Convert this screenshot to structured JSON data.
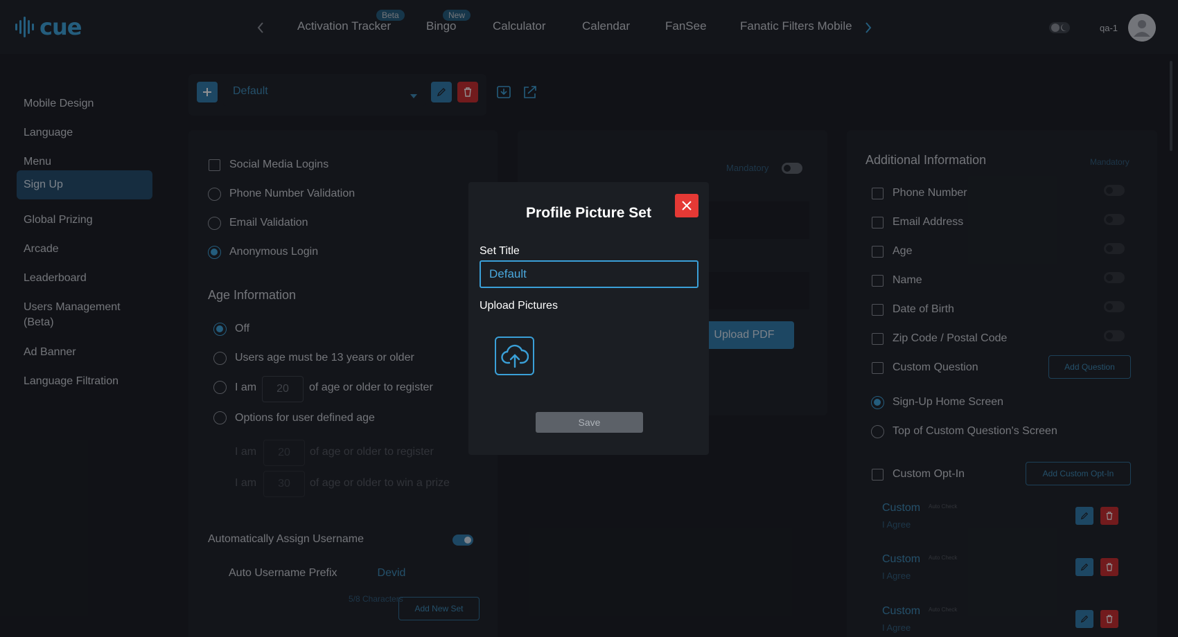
{
  "app": {
    "logo_text": "cue",
    "brand_color": "#3aa0d8"
  },
  "nav": {
    "tabs": [
      {
        "label": "Activation Tracker",
        "badge": "Beta"
      },
      {
        "label": "Bingo",
        "badge": "New"
      },
      {
        "label": "Calculator"
      },
      {
        "label": "Calendar"
      },
      {
        "label": "FanSee"
      },
      {
        "label": "Fanatic Filters Mobile"
      }
    ],
    "user": "qa-1"
  },
  "sidebar": {
    "items": [
      {
        "label": "Mobile Design"
      },
      {
        "label": "Language"
      },
      {
        "label": "Menu"
      },
      {
        "label": "Sign Up",
        "active": true
      },
      {
        "label": "Global Prizing"
      },
      {
        "label": "Arcade"
      },
      {
        "label": "Leaderboard"
      },
      {
        "label": "Users Management (Beta)"
      },
      {
        "label": "Ad Banner"
      },
      {
        "label": "Language Filtration"
      }
    ]
  },
  "toolbar": {
    "set_select": "Default"
  },
  "left_panel": {
    "login_options": [
      {
        "label": "Social Media Logins",
        "type": "checkbox"
      },
      {
        "label": "Phone Number Validation",
        "type": "radio"
      },
      {
        "label": "Email Validation",
        "type": "radio"
      },
      {
        "label": "Anonymous Login",
        "type": "radio",
        "selected": true
      }
    ],
    "age_title": "Age Information",
    "age_off": "Off",
    "age_13": "Users age must be 13 years or older",
    "age_i_am": "I am",
    "age_value": "20",
    "age_suffix": "of age or older to register",
    "age_user_defined": "Options for user defined age",
    "age_sub1_prefix": "I am",
    "age_sub1_value": "20",
    "age_sub1_suffix": "of age or older to register",
    "age_sub2_prefix": "I am",
    "age_sub2_value": "30",
    "age_sub2_suffix": "of age or older to win a prize",
    "auto_username": "Automatically Assign Username",
    "prefix_label": "Auto Username Prefix",
    "prefix_value": "Devid",
    "char_count": "5/8 Characters",
    "add_new_set": "Add New Set"
  },
  "middle_panel": {
    "mandatory": "Mandatory",
    "upload_pdf": "Upload PDF"
  },
  "right_panel": {
    "title": "Additional Information",
    "mandatory": "Mandatory",
    "fields": [
      {
        "label": "Phone Number"
      },
      {
        "label": "Email Address"
      },
      {
        "label": "Age"
      },
      {
        "label": "Name"
      },
      {
        "label": "Date of Birth"
      },
      {
        "label": "Zip Code / Postal Code"
      }
    ],
    "custom_question": "Custom Question",
    "add_question": "Add Question",
    "signup_home": "Sign-Up Home Screen",
    "top_custom": "Top of Custom Question's Screen",
    "custom_opt_in": "Custom Opt-In",
    "add_custom_opt_in": "Add Custom Opt-In",
    "opt_ins": [
      {
        "title": "Custom",
        "tag": "Auto Check",
        "sub": "I Agree"
      },
      {
        "title": "Custom",
        "tag": "Auto Check",
        "sub": "I Agree"
      },
      {
        "title": "Custom",
        "tag": "Auto Check",
        "sub": "I Agree"
      }
    ]
  },
  "modal": {
    "title": "Profile Picture Set",
    "set_title_label": "Set Title",
    "set_title_value": "Default",
    "upload_label": "Upload Pictures",
    "save": "Save"
  }
}
